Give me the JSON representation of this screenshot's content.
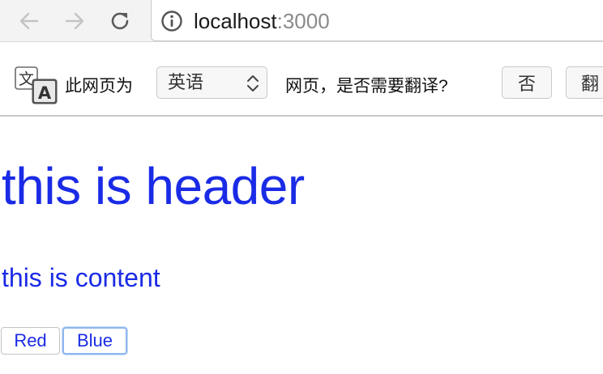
{
  "browser": {
    "url_host": "localhost",
    "url_port": ":3000"
  },
  "translate_bar": {
    "prefix": "此网页为",
    "language": "英语",
    "question": "网页，是否需要翻译?",
    "no_label": "否",
    "translate_label": "翻"
  },
  "page": {
    "header": "this is header",
    "content": "this is content",
    "buttons": [
      {
        "label": "Red"
      },
      {
        "label": "Blue"
      }
    ]
  }
}
